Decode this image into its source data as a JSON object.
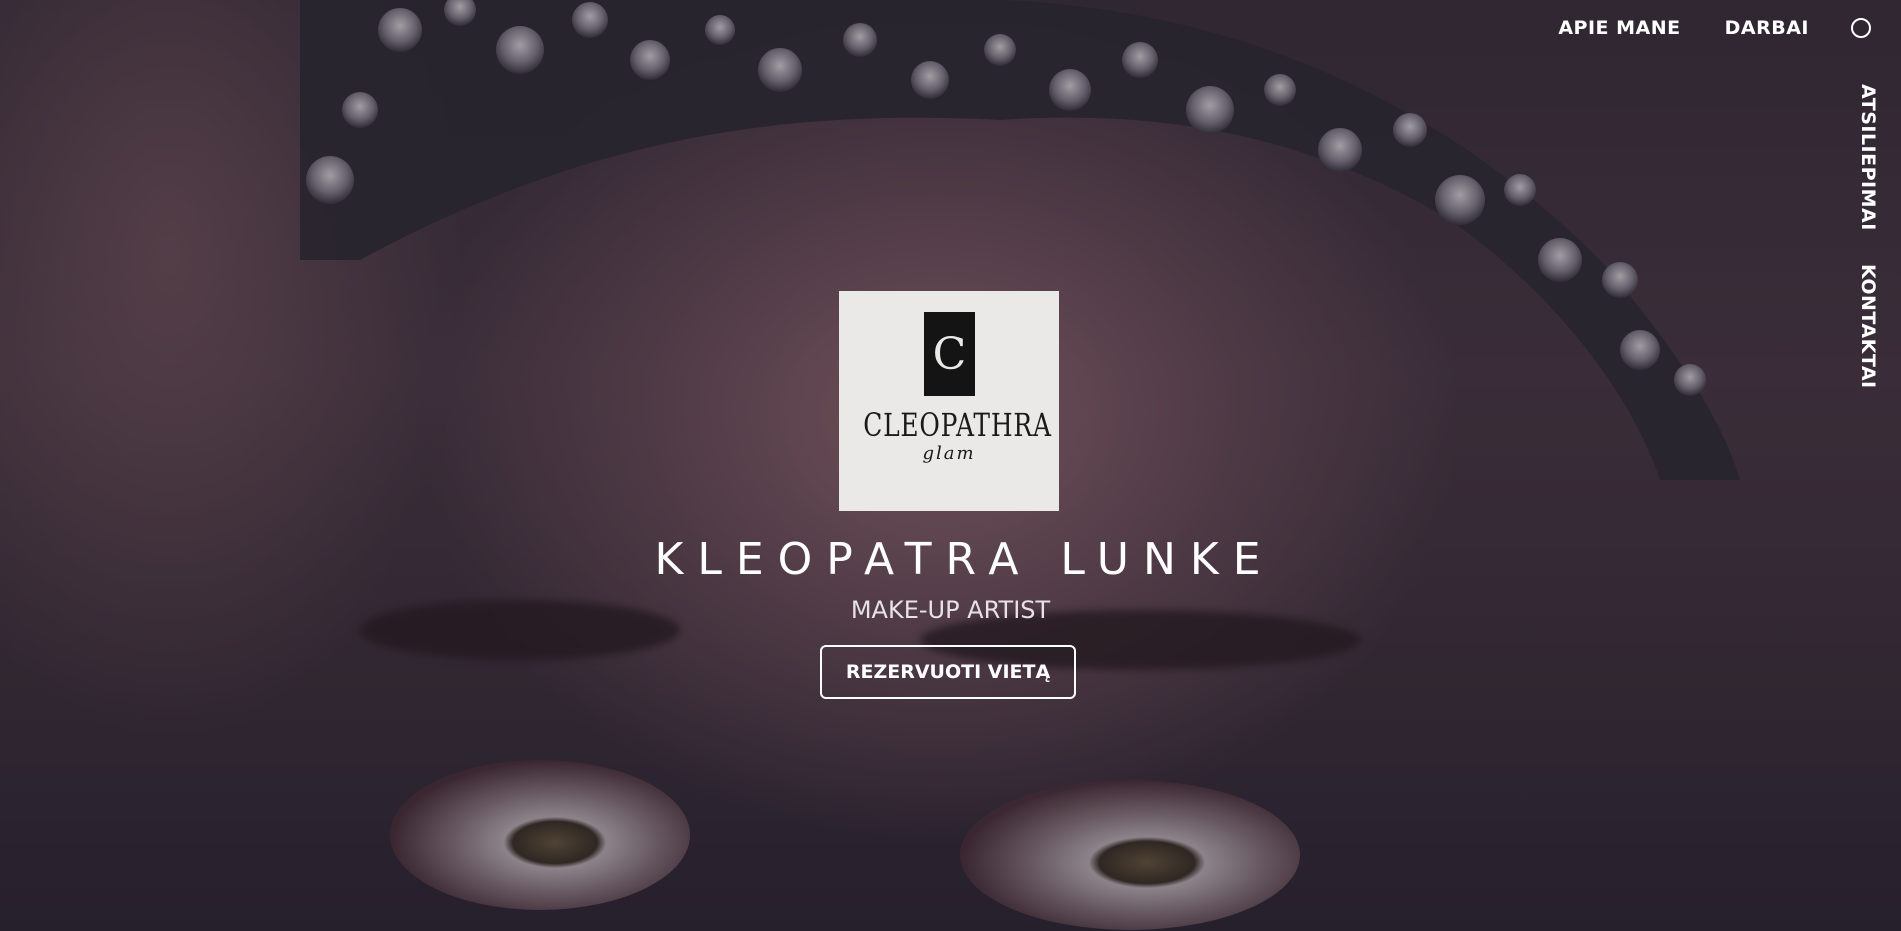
{
  "nav": {
    "about": "APIE MANE",
    "works": "DARBAI",
    "reviews": "ATSILIEPIMAI",
    "contacts": "KONTAKTAI"
  },
  "logo": {
    "mark": "C",
    "name": "CLEOPATHRA",
    "sub": "glam"
  },
  "hero": {
    "title": "KLEOPATRA LUNKE",
    "subtitle": "MAKE-UP ARTIST",
    "cta_label": "REZERVUOTI VIETĄ"
  },
  "colors": {
    "overlay": "#1e1928",
    "text": "#ffffff",
    "logo_bg": "#ebe8e8"
  }
}
